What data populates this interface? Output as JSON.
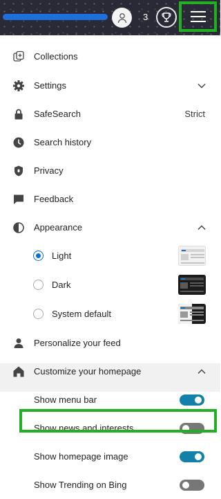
{
  "header": {
    "reward_count": "3",
    "icons": {
      "avatar": "person-icon",
      "rewards": "trophy-icon",
      "menu": "hamburger-icon"
    }
  },
  "menu": {
    "collections": "Collections",
    "settings": "Settings",
    "safesearch": "SafeSearch",
    "safesearch_value": "Strict",
    "search_history": "Search history",
    "privacy": "Privacy",
    "feedback": "Feedback",
    "appearance": "Appearance",
    "appearance_options": [
      {
        "label": "Light",
        "selected": true
      },
      {
        "label": "Dark",
        "selected": false
      },
      {
        "label": "System default",
        "selected": false
      }
    ],
    "personalize": "Personalize your feed",
    "customize": "Customize your homepage",
    "homepage_options": [
      {
        "label": "Show menu bar",
        "on": true
      },
      {
        "label": "Show news and interests",
        "on": false
      },
      {
        "label": "Show homepage image",
        "on": true
      },
      {
        "label": "Show Trending on Bing",
        "on": false
      }
    ]
  },
  "colors": {
    "accent": "#1280a8",
    "radio": "#0a6fd0",
    "highlight": "#22b022",
    "topbar": "#2a2a36"
  }
}
